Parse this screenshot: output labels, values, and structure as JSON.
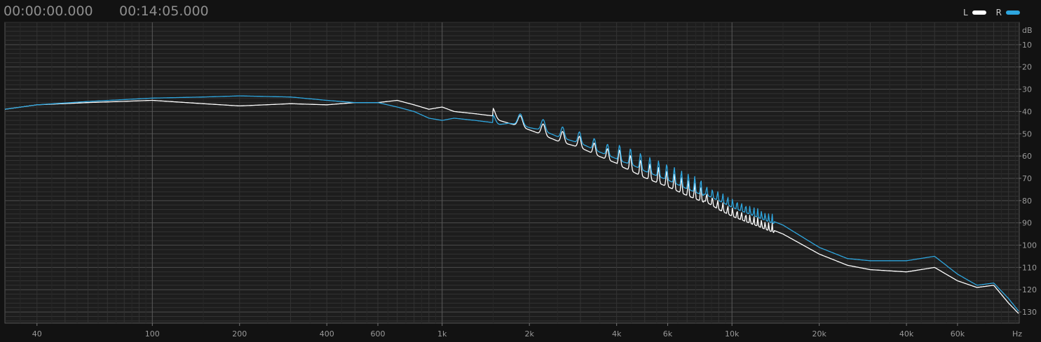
{
  "header": {
    "time_start": "00:00:00.000",
    "time_end": "00:14:05.000"
  },
  "legend": [
    {
      "label": "L",
      "color": "#ffffff"
    },
    {
      "label": "R",
      "color": "#2ea6df"
    }
  ],
  "colors": {
    "background": "#121212",
    "plot_background": "#1d1d1d",
    "grid_major": "#4a4a4a",
    "grid_minor": "#333333",
    "left": "#ffffff",
    "right": "#2ea6df"
  },
  "chart_data": {
    "type": "line",
    "x_scale": "log",
    "x_unit": "Hz",
    "y_unit": "dB",
    "xlim": [
      31,
      98000
    ],
    "ylim": [
      -135,
      0
    ],
    "x_tick_labels": [
      {
        "value": 40,
        "label": "40"
      },
      {
        "value": 100,
        "label": "100"
      },
      {
        "value": 200,
        "label": "200"
      },
      {
        "value": 400,
        "label": "400"
      },
      {
        "value": 600,
        "label": "600"
      },
      {
        "value": 1000,
        "label": "1k"
      },
      {
        "value": 2000,
        "label": "2k"
      },
      {
        "value": 4000,
        "label": "4k"
      },
      {
        "value": 6000,
        "label": "6k"
      },
      {
        "value": 10000,
        "label": "10k"
      },
      {
        "value": 20000,
        "label": "20k"
      },
      {
        "value": 40000,
        "label": "40k"
      },
      {
        "value": 60000,
        "label": "60k"
      }
    ],
    "x_unit_label": "Hz",
    "y_tick_labels": [
      {
        "value": -10,
        "label": "10"
      },
      {
        "value": -20,
        "label": "20"
      },
      {
        "value": -30,
        "label": "30"
      },
      {
        "value": -40,
        "label": "40"
      },
      {
        "value": -50,
        "label": "50"
      },
      {
        "value": -60,
        "label": "60"
      },
      {
        "value": -70,
        "label": "70"
      },
      {
        "value": -80,
        "label": "80"
      },
      {
        "value": -90,
        "label": "90"
      },
      {
        "value": -100,
        "label": "100"
      },
      {
        "value": -110,
        "label": "110"
      },
      {
        "value": -120,
        "label": "120"
      },
      {
        "value": -130,
        "label": "130"
      }
    ],
    "y_unit_label": "dB",
    "series": [
      {
        "name": "L",
        "color": "#ffffff",
        "x": [
          31,
          40,
          60,
          100,
          150,
          200,
          300,
          400,
          500,
          600,
          700,
          800,
          900,
          1000,
          1100,
          1300,
          1500,
          1700,
          1900,
          2000,
          2200,
          2500,
          3000,
          3500,
          4000,
          4500,
          5000,
          6000,
          7000,
          8000,
          9000,
          10000,
          12000,
          15000,
          20000,
          25000,
          30000,
          40000,
          50000,
          60000,
          70000,
          80000,
          90000,
          98000
        ],
        "y": [
          -39,
          -37,
          -36,
          -35,
          -36.5,
          -37.5,
          -36.5,
          -37,
          -36,
          -36,
          -35,
          -37,
          -39,
          -38,
          -40,
          -41,
          -42,
          -44,
          -46,
          -47,
          -49,
          -52,
          -55,
          -59,
          -62,
          -65,
          -68,
          -72,
          -76,
          -79,
          -83,
          -86,
          -90,
          -95,
          -104,
          -109,
          -111,
          -112,
          -110,
          -116,
          -119,
          -118,
          -126,
          -131
        ]
      },
      {
        "name": "R",
        "color": "#2ea6df",
        "x": [
          31,
          40,
          60,
          100,
          150,
          200,
          300,
          400,
          500,
          600,
          700,
          800,
          900,
          1000,
          1100,
          1300,
          1500,
          1700,
          1900,
          2000,
          2200,
          2500,
          3000,
          3500,
          4000,
          4500,
          5000,
          6000,
          7000,
          8000,
          9000,
          10000,
          12000,
          15000,
          20000,
          25000,
          30000,
          40000,
          50000,
          60000,
          70000,
          80000,
          90000,
          98000
        ],
        "y": [
          -39,
          -37,
          -35.5,
          -34,
          -33.5,
          -33,
          -33.5,
          -35,
          -36,
          -36,
          -38,
          -40,
          -43,
          -44,
          -43,
          -44,
          -45,
          -44,
          -45,
          -46,
          -47,
          -50,
          -53,
          -57,
          -60,
          -62,
          -65,
          -69,
          -73,
          -76,
          -79,
          -82,
          -86,
          -91,
          -101,
          -106,
          -107,
          -107,
          -105,
          -113,
          -118,
          -117,
          -124,
          -130
        ]
      }
    ]
  }
}
